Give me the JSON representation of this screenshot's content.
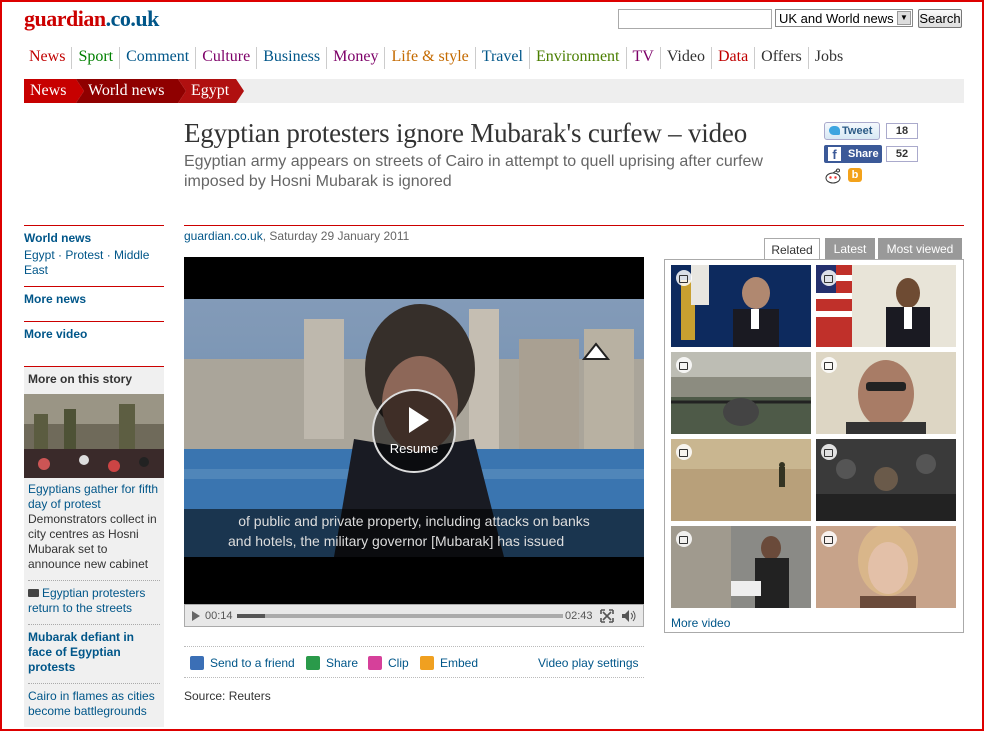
{
  "header": {
    "logo_main": "guardian",
    "logo_tld": ".co.uk",
    "search_placeholder": "",
    "section_select": "UK and World news",
    "search_button": "Search"
  },
  "nav": [
    {
      "label": "News",
      "color": "#c00000"
    },
    {
      "label": "Sport",
      "color": "#008000"
    },
    {
      "label": "Comment",
      "color": "#005689"
    },
    {
      "label": "Culture",
      "color": "#7d0068"
    },
    {
      "label": "Business",
      "color": "#005689"
    },
    {
      "label": "Money",
      "color": "#7d0068"
    },
    {
      "label": "Life & style",
      "color": "#c46a00"
    },
    {
      "label": "Travel",
      "color": "#005689"
    },
    {
      "label": "Environment",
      "color": "#4a7e00"
    },
    {
      "label": "TV",
      "color": "#7d0068"
    },
    {
      "label": "Video",
      "color": "#333333"
    },
    {
      "label": "Data",
      "color": "#c00000"
    },
    {
      "label": "Offers",
      "color": "#333333"
    },
    {
      "label": "Jobs",
      "color": "#333333"
    }
  ],
  "breadcrumb": {
    "items": [
      "News",
      "World news",
      "Egypt"
    ],
    "colors": [
      "#c70000",
      "#8f0000",
      "#b01010"
    ]
  },
  "article": {
    "headline": "Egyptian protesters ignore Mubarak's curfew – video",
    "standfirst": "Egyptian army appears on streets of Cairo in attempt to quell uprising after curfew imposed by Hosni Mubarak is ignored",
    "byline_source": "guardian.co.uk",
    "byline_date": ", Saturday 29 January 2011",
    "source": "Source: Reuters"
  },
  "share": {
    "tweet_label": "Tweet",
    "tweet_count": "18",
    "facebook_label": "Share",
    "facebook_count": "52",
    "bebo_letter": "b"
  },
  "left_nav": {
    "world_news": "World news",
    "world_news_links": "Egypt · Protest · Middle East",
    "more_news": "More news",
    "more_video": "More video",
    "more_on_story": "More on this story",
    "story1_link": "Egyptians gather for fifth day of protest",
    "story1_desc": "Demonstrators collect in city centres as Hosni Mubarak set to announce new cabinet",
    "story2_link": "Egyptian protesters return to the streets",
    "story3_link": "Mubarak defiant in face of Egyptian protests",
    "story4_link": "Cairo in flames as cities become battlegrounds"
  },
  "video": {
    "resume_label": "Resume",
    "subtitle_line1": "of public and private property, including attacks on banks",
    "subtitle_line2": "and hotels, the military governor [Mubarak] has issued",
    "elapsed": "00:14",
    "duration": "02:43",
    "progress_fraction": 0.086
  },
  "video_actions": {
    "send": "Send to a friend",
    "share": "Share",
    "clip": "Clip",
    "embed": "Embed",
    "settings": "Video play settings"
  },
  "related": {
    "tabs": [
      "Related",
      "Latest",
      "Most viewed"
    ],
    "more_video": "More video"
  }
}
